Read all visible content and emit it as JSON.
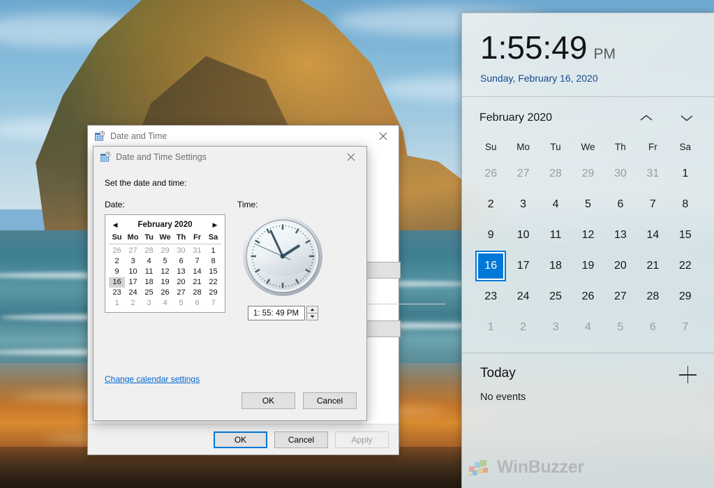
{
  "flyout": {
    "time": "1:55:49",
    "ampm": "PM",
    "date_long": "Sunday, February 16, 2020",
    "calendar": {
      "title": "February 2020",
      "prev_icon": "chevron-up-icon",
      "next_icon": "chevron-down-icon",
      "dow": [
        "Su",
        "Mo",
        "Tu",
        "We",
        "Th",
        "Fr",
        "Sa"
      ],
      "weeks": [
        [
          {
            "d": "26",
            "o": true
          },
          {
            "d": "27",
            "o": true
          },
          {
            "d": "28",
            "o": true
          },
          {
            "d": "29",
            "o": true
          },
          {
            "d": "30",
            "o": true
          },
          {
            "d": "31",
            "o": true
          },
          {
            "d": "1",
            "o": false
          }
        ],
        [
          {
            "d": "2",
            "o": false
          },
          {
            "d": "3",
            "o": false
          },
          {
            "d": "4",
            "o": false
          },
          {
            "d": "5",
            "o": false
          },
          {
            "d": "6",
            "o": false
          },
          {
            "d": "7",
            "o": false
          },
          {
            "d": "8",
            "o": false
          }
        ],
        [
          {
            "d": "9",
            "o": false
          },
          {
            "d": "10",
            "o": false
          },
          {
            "d": "11",
            "o": false
          },
          {
            "d": "12",
            "o": false
          },
          {
            "d": "13",
            "o": false
          },
          {
            "d": "14",
            "o": false
          },
          {
            "d": "15",
            "o": false
          }
        ],
        [
          {
            "d": "16",
            "o": false,
            "sel": true
          },
          {
            "d": "17",
            "o": false
          },
          {
            "d": "18",
            "o": false
          },
          {
            "d": "19",
            "o": false
          },
          {
            "d": "20",
            "o": false
          },
          {
            "d": "21",
            "o": false
          },
          {
            "d": "22",
            "o": false
          }
        ],
        [
          {
            "d": "23",
            "o": false
          },
          {
            "d": "24",
            "o": false
          },
          {
            "d": "25",
            "o": false
          },
          {
            "d": "26",
            "o": false
          },
          {
            "d": "27",
            "o": false
          },
          {
            "d": "28",
            "o": false
          },
          {
            "d": "29",
            "o": false
          }
        ],
        [
          {
            "d": "1",
            "o": true
          },
          {
            "d": "2",
            "o": true
          },
          {
            "d": "3",
            "o": true
          },
          {
            "d": "4",
            "o": true
          },
          {
            "d": "5",
            "o": true
          },
          {
            "d": "6",
            "o": true
          },
          {
            "d": "7",
            "o": true
          }
        ]
      ],
      "selected_day": "16",
      "selected_color": "#0078d7"
    },
    "agenda": {
      "title": "Today",
      "empty_text": "No events",
      "add_icon": "plus-icon"
    }
  },
  "watermark": {
    "text": "WinBuzzer"
  },
  "back_dialog": {
    "title": "Date and Time",
    "icon": "date-time-icon",
    "close_icon": "close-icon",
    "buttons": {
      "ok": "OK",
      "cancel": "Cancel",
      "apply": "Apply"
    }
  },
  "front_dialog": {
    "title": "Date and Time Settings",
    "icon": "date-time-icon",
    "close_icon": "close-icon",
    "heading": "Set the date and time:",
    "date_label": "Date:",
    "time_label": "Time:",
    "mini_calendar": {
      "title": "February 2020",
      "prev_icon": "triangle-left-icon",
      "next_icon": "triangle-right-icon",
      "dow": [
        "Su",
        "Mo",
        "Tu",
        "We",
        "Th",
        "Fr",
        "Sa"
      ],
      "weeks": [
        [
          {
            "d": "26",
            "o": true
          },
          {
            "d": "27",
            "o": true
          },
          {
            "d": "28",
            "o": true
          },
          {
            "d": "29",
            "o": true
          },
          {
            "d": "30",
            "o": true
          },
          {
            "d": "31",
            "o": true
          },
          {
            "d": "1",
            "o": false
          }
        ],
        [
          {
            "d": "2",
            "o": false
          },
          {
            "d": "3",
            "o": false
          },
          {
            "d": "4",
            "o": false
          },
          {
            "d": "5",
            "o": false
          },
          {
            "d": "6",
            "o": false
          },
          {
            "d": "7",
            "o": false
          },
          {
            "d": "8",
            "o": false
          }
        ],
        [
          {
            "d": "9",
            "o": false
          },
          {
            "d": "10",
            "o": false
          },
          {
            "d": "11",
            "o": false
          },
          {
            "d": "12",
            "o": false
          },
          {
            "d": "13",
            "o": false
          },
          {
            "d": "14",
            "o": false
          },
          {
            "d": "15",
            "o": false
          }
        ],
        [
          {
            "d": "16",
            "o": false,
            "sel": true
          },
          {
            "d": "17",
            "o": false
          },
          {
            "d": "18",
            "o": false
          },
          {
            "d": "19",
            "o": false
          },
          {
            "d": "20",
            "o": false
          },
          {
            "d": "21",
            "o": false
          },
          {
            "d": "22",
            "o": false
          }
        ],
        [
          {
            "d": "23",
            "o": false
          },
          {
            "d": "24",
            "o": false
          },
          {
            "d": "25",
            "o": false
          },
          {
            "d": "26",
            "o": false
          },
          {
            "d": "27",
            "o": false
          },
          {
            "d": "28",
            "o": false
          },
          {
            "d": "29",
            "o": false
          }
        ],
        [
          {
            "d": "1",
            "o": true
          },
          {
            "d": "2",
            "o": true
          },
          {
            "d": "3",
            "o": true
          },
          {
            "d": "4",
            "o": true
          },
          {
            "d": "5",
            "o": true
          },
          {
            "d": "6",
            "o": true
          },
          {
            "d": "7",
            "o": true
          }
        ]
      ]
    },
    "time_value": "1: 55: 49 PM",
    "clock": {
      "hour": 1,
      "minute": 55,
      "second": 49
    },
    "link": "Change calendar settings",
    "buttons": {
      "ok": "OK",
      "cancel": "Cancel"
    }
  }
}
